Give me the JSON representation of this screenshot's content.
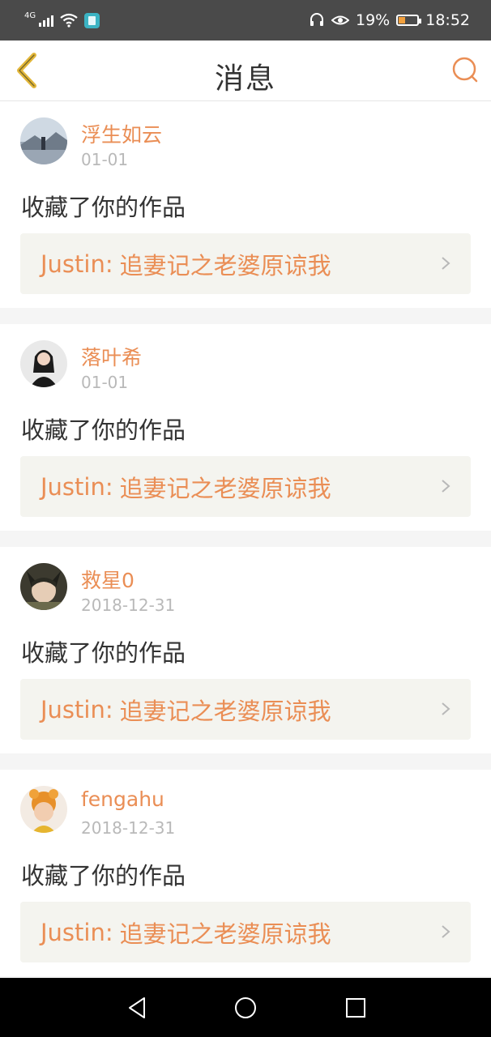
{
  "status_bar": {
    "network": "4G",
    "battery": "19%",
    "time": "18:52"
  },
  "header": {
    "title": "消息"
  },
  "messages": [
    {
      "username": "浮生如云",
      "date": "01-01",
      "action": "收藏了你的作品",
      "work_author": "Justin",
      "work_sep": ":",
      "work_title": "追妻记之老婆原谅我"
    },
    {
      "username": "落叶希",
      "date": "01-01",
      "action": "收藏了你的作品",
      "work_author": "Justin",
      "work_sep": ":",
      "work_title": "追妻记之老婆原谅我"
    },
    {
      "username": "救星0",
      "date": "2018-12-31",
      "action": "收藏了你的作品",
      "work_author": "Justin",
      "work_sep": ":",
      "work_title": "追妻记之老婆原谅我"
    },
    {
      "username": "fengahu",
      "date": "2018-12-31",
      "action": "收藏了你的作品",
      "work_author": "Justin",
      "work_sep": ":",
      "work_title": "追妻记之老婆原谅我"
    }
  ],
  "colors": {
    "accent": "#ea8e55",
    "status_bar_bg": "#4a4a4a",
    "card_box_bg": "#f4f4ef"
  },
  "icons": {
    "back": "chevron-left-icon",
    "search": "search-icon",
    "arrow": "chevron-right-icon",
    "nav": [
      "nav-back-icon",
      "nav-home-icon",
      "nav-recent-icon"
    ]
  }
}
